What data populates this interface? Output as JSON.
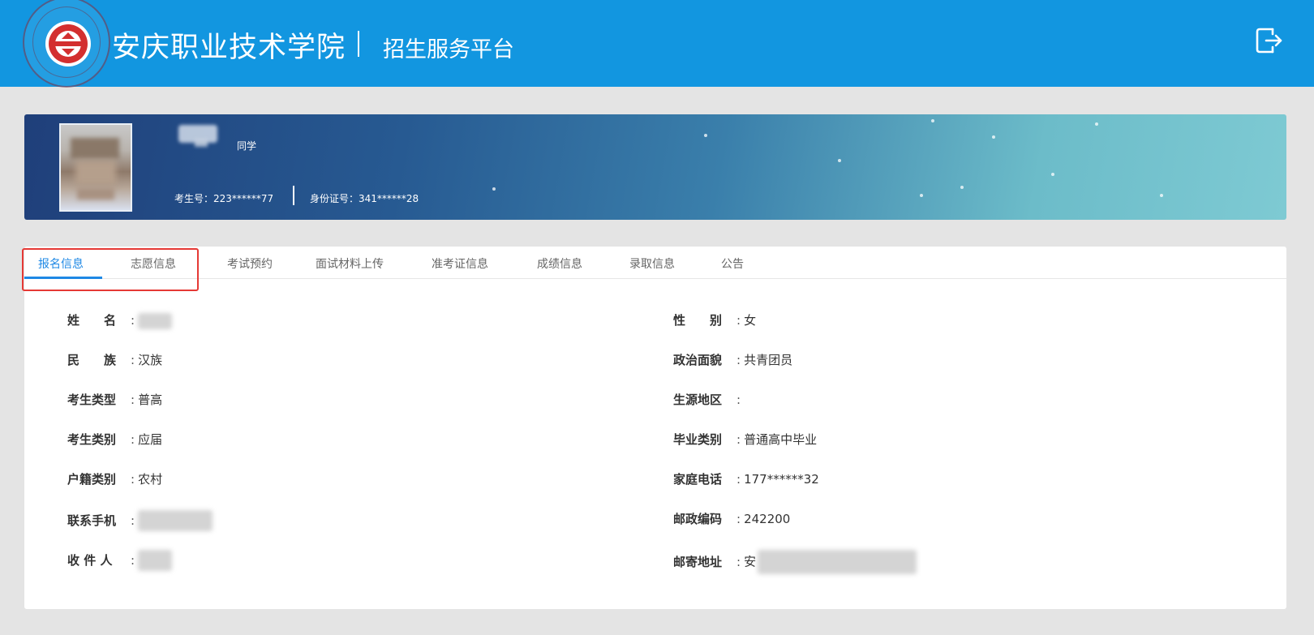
{
  "header": {
    "title": "安庆职业技术学院",
    "subtitle": "招生服务平台",
    "logout_icon": "logout-icon",
    "bg_color": "#1296e0"
  },
  "profile": {
    "greeting": "同学",
    "exam_no": "考生号：223******77",
    "id_no": "身份证号：341******28"
  },
  "tabs": [
    {
      "label": "报名信息",
      "active": true
    },
    {
      "label": "志愿信息",
      "active": false
    },
    {
      "label": "考试预约",
      "active": false
    },
    {
      "label": "面试材料上传",
      "active": false
    },
    {
      "label": "准考证信息",
      "active": false
    },
    {
      "label": "成绩信息",
      "active": false
    },
    {
      "label": "录取信息",
      "active": false
    },
    {
      "label": "公告",
      "active": false
    }
  ],
  "fields": {
    "name": {
      "label": "姓　　名",
      "value": ""
    },
    "gender": {
      "label": "性　　别",
      "value": "女"
    },
    "ethnicity": {
      "label": "民　　族",
      "value": "汉族"
    },
    "political": {
      "label": "政治面貌",
      "value": "共青团员"
    },
    "student_type": {
      "label": "考生类型",
      "value": "普高"
    },
    "origin_region": {
      "label": "生源地区",
      "value": ""
    },
    "student_category": {
      "label": "考生类别",
      "value": "应届"
    },
    "graduation_type": {
      "label": "毕业类别",
      "value": "普通高中毕业"
    },
    "household_type": {
      "label": "户籍类别",
      "value": "农村"
    },
    "home_phone": {
      "label": "家庭电话",
      "value": "177******32"
    },
    "mobile": {
      "label": "联系手机",
      "value": ""
    },
    "postcode": {
      "label": "邮政编码",
      "value": "242200"
    },
    "recipient": {
      "label": "收 件 人",
      "value": ""
    },
    "mail_address": {
      "label": "邮寄地址",
      "value": "安"
    }
  },
  "colors": {
    "accent": "#1e88e5",
    "highlight_box": "#e53935"
  }
}
